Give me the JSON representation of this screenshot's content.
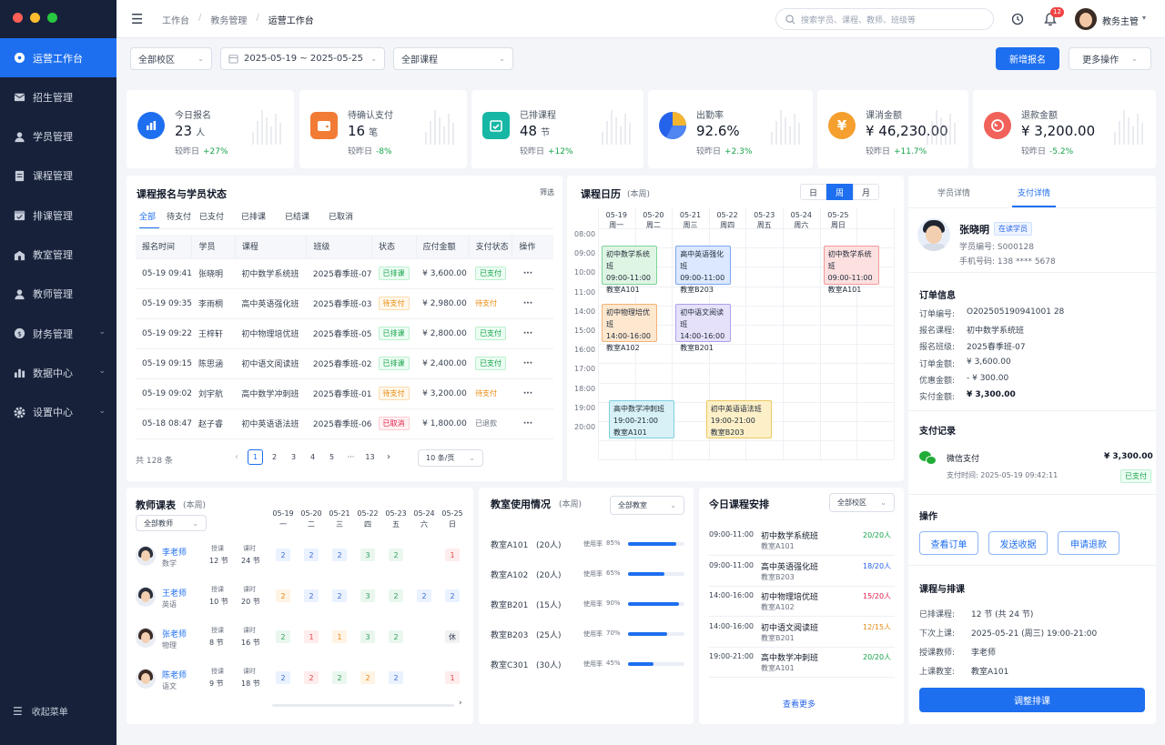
{
  "sidebar": {
    "items": [
      {
        "label": "运营工作台",
        "icon": "dashboard-icon",
        "active": true
      },
      {
        "label": "招生管理",
        "icon": "enrollment-icon"
      },
      {
        "label": "学员管理",
        "icon": "student-icon"
      },
      {
        "label": "课程管理",
        "icon": "course-icon"
      },
      {
        "label": "排课管理",
        "icon": "schedule-icon"
      },
      {
        "label": "教室管理",
        "icon": "classroom-icon"
      },
      {
        "label": "教师管理",
        "icon": "teacher-icon"
      },
      {
        "label": "财务管理",
        "icon": "finance-icon",
        "expandable": true
      },
      {
        "label": "数据中心",
        "icon": "data-icon",
        "expandable": true
      },
      {
        "label": "设置中心",
        "icon": "settings-icon",
        "expandable": true
      }
    ],
    "collapse_label": "收起菜单"
  },
  "topbar": {
    "breadcrumb": [
      "工作台",
      "教务管理",
      "运营工作台"
    ],
    "search_placeholder": "搜索学员、课程、教师、班级等",
    "notification_count": "12",
    "user_name": "教务主管"
  },
  "filters": {
    "campus": "全部校区",
    "date_range": "2025-05-19 ~ 2025-05-25",
    "course": "全部课程",
    "new_button": "新增报名",
    "more_button": "更多操作"
  },
  "stats": [
    {
      "label": "今日报名",
      "value": "23",
      "unit": "人",
      "compare": "较昨日",
      "delta": "+27%",
      "color": "#1e6ff0",
      "icon": "bar-chart-icon"
    },
    {
      "label": "待确认支付",
      "value": "16",
      "unit": "笔",
      "compare": "较昨日",
      "delta": "-8%",
      "color": "#f27b35",
      "icon": "wallet-icon"
    },
    {
      "label": "已排课程",
      "value": "48",
      "unit": "节",
      "compare": "较昨日",
      "delta": "+12%",
      "color": "#16b7a4",
      "icon": "calendar-check-icon"
    },
    {
      "label": "出勤率",
      "value": "92.6%",
      "unit": "",
      "compare": "较昨日",
      "delta": "+2.3%",
      "color": "#2563eb",
      "icon": "pie-chart-icon"
    },
    {
      "label": "课消金额",
      "value": "¥ 46,230.00",
      "unit": "",
      "compare": "较昨日",
      "delta": "+11.7%",
      "color": "#f59f2e",
      "icon": "yen-icon"
    },
    {
      "label": "退款金额",
      "value": "¥ 3,200.00",
      "unit": "",
      "compare": "较昨日",
      "delta": "-5.2%",
      "color": "#f0625a",
      "icon": "refund-icon"
    }
  ],
  "enrollment": {
    "title": "课程报名与学员状态",
    "filter_link": "筛选",
    "tabs": [
      "全部",
      "待支付",
      "已支付",
      "已排课",
      "已结课",
      "已取消"
    ],
    "headers": [
      "报名时间",
      "学员",
      "课程",
      "班级",
      "状态",
      "应付金额",
      "支付状态",
      "操作"
    ],
    "rows": [
      {
        "time": "05-19 09:41",
        "student": "张晓明",
        "course": "初中数学系统班",
        "class": "2025春季班-07",
        "status": "已排课",
        "status_color": "green",
        "amount": "¥ 3,600.00",
        "pay": "已支付",
        "pay_color": "green",
        "more": "···"
      },
      {
        "time": "05-19 09:35",
        "student": "李雨桐",
        "course": "高中英语强化班",
        "class": "2025春季班-03",
        "status": "待支付",
        "status_color": "orange",
        "amount": "¥ 2,980.00",
        "pay": "待支付",
        "pay_color": "orange-text",
        "more": "···"
      },
      {
        "time": "05-19 09:22",
        "student": "王梓轩",
        "course": "初中物理培优班",
        "class": "2025春季班-05",
        "status": "已排课",
        "status_color": "green",
        "amount": "¥ 2,800.00",
        "pay": "已支付",
        "pay_color": "green",
        "more": "···"
      },
      {
        "time": "05-19 09:15",
        "student": "陈思涵",
        "course": "初中语文阅读班",
        "class": "2025春季班-02",
        "status": "已排课",
        "status_color": "green",
        "amount": "¥ 2,400.00",
        "pay": "已支付",
        "pay_color": "green",
        "more": "···"
      },
      {
        "time": "05-19 09:02",
        "student": "刘宇航",
        "course": "高中数学冲刺班",
        "class": "2025春季班-01",
        "status": "待支付",
        "status_color": "orange",
        "amount": "¥ 3,200.00",
        "pay": "待支付",
        "pay_color": "orange-text",
        "more": "···"
      },
      {
        "time": "05-18 08:47",
        "student": "赵子睿",
        "course": "初中英语语法班",
        "class": "2025春季班-06",
        "status": "已取消",
        "status_color": "red",
        "amount": "¥ 1,800.00",
        "pay": "已退款",
        "pay_color": "gray-text",
        "more": "···"
      }
    ],
    "total": "共 128 条",
    "pages": [
      "1",
      "2",
      "3",
      "4",
      "5",
      "···",
      "13"
    ],
    "page_size": "10 条/页"
  },
  "calendar": {
    "title": "课程日历",
    "subtitle": "(本周)",
    "views": [
      "日",
      "周",
      "月"
    ],
    "active_view": "周",
    "days": [
      {
        "date": "05-19",
        "wd": "周一"
      },
      {
        "date": "05-20",
        "wd": "周二"
      },
      {
        "date": "05-21",
        "wd": "周三"
      },
      {
        "date": "05-22",
        "wd": "周四"
      },
      {
        "date": "05-23",
        "wd": "周五"
      },
      {
        "date": "05-24",
        "wd": "周六"
      },
      {
        "date": "05-25",
        "wd": "周日"
      }
    ],
    "hours": [
      "08:00",
      "09:00",
      "10:00",
      "11:00",
      "14:00",
      "15:00",
      "16:00",
      "17:00",
      "18:00",
      "19:00",
      "20:00"
    ],
    "events": [
      {
        "name": "初中数学系统班",
        "time": "09:00-11:00",
        "room": "教室A101",
        "color": "green",
        "day": 0,
        "start": 1,
        "end": 3
      },
      {
        "name": "高中英语强化班",
        "time": "09:00-11:00",
        "room": "教室B203",
        "color": "blue",
        "day": 2,
        "start": 1,
        "end": 3
      },
      {
        "name": "初中数学系统班",
        "time": "09:00-11:00",
        "room": "教室A101",
        "color": "red",
        "day": 6,
        "start": 1,
        "end": 3
      },
      {
        "name": "初中物理培优班",
        "time": "14:00-16:00",
        "room": "教室A102",
        "color": "orange",
        "day": 0,
        "start": 4,
        "end": 6
      },
      {
        "name": "初中语文阅读班",
        "time": "14:00-16:00",
        "room": "教室B201",
        "color": "purple",
        "day": 2,
        "start": 4,
        "end": 6
      },
      {
        "name": "高中数学冲刺班",
        "time": "19:00-21:00",
        "room": "教室A101",
        "color": "cyan",
        "day": 0,
        "start": 9,
        "end": 11
      },
      {
        "name": "初中英语语法班",
        "time": "19:00-21:00",
        "room": "教室B203",
        "color": "yellow",
        "day": 3,
        "start": 9,
        "end": 11
      }
    ]
  },
  "detail": {
    "tabs": [
      "学员详情",
      "支付详情"
    ],
    "active_tab": "支付详情",
    "student": {
      "name": "张晓明",
      "badge": "在读学员",
      "id_label": "学员编号:",
      "id": "S000128",
      "phone_label": "手机号码:",
      "phone": "138 **** 5678"
    },
    "order_title": "订单信息",
    "order": [
      {
        "k": "订单编号:",
        "v": "O202505190941001 28"
      },
      {
        "k": "报名课程:",
        "v": "初中数学系统班"
      },
      {
        "k": "报名班级:",
        "v": "2025春季班-07"
      },
      {
        "k": "订单金额:",
        "v": "¥ 3,600.00"
      },
      {
        "k": "优惠金额:",
        "v": "- ¥ 300.00"
      },
      {
        "k": "实付金额:",
        "v": "¥ 3,300.00"
      }
    ],
    "pay_title": "支付记录",
    "pay_method": "微信支付",
    "pay_amount": "¥ 3,300.00",
    "pay_time": "支付时间: 2025-05-19 09:42:11",
    "pay_status": "已支付",
    "ops_title": "操作",
    "ops": [
      "查看订单",
      "发送收据",
      "申请退款"
    ],
    "sched_title": "课程与排课",
    "sched": [
      {
        "k": "已排课程:",
        "v": "12 节 (共 24 节)"
      },
      {
        "k": "下次上课:",
        "v": "2025-05-21 (周三) 19:00-21:00"
      },
      {
        "k": "授课教师:",
        "v": "李老师"
      },
      {
        "k": "上课教室:",
        "v": "教室A101"
      }
    ],
    "adjust_button": "调整排课"
  },
  "teachers": {
    "title": "教师课表",
    "subtitle": "(本周)",
    "filter": "全部教师",
    "days": [
      {
        "date": "05-19",
        "wd": "一"
      },
      {
        "date": "05-20",
        "wd": "二"
      },
      {
        "date": "05-21",
        "wd": "三"
      },
      {
        "date": "05-22",
        "wd": "四"
      },
      {
        "date": "05-23",
        "wd": "五"
      },
      {
        "date": "05-24",
        "wd": "六"
      },
      {
        "date": "05-25",
        "wd": "日"
      }
    ],
    "class_label": "授课",
    "hour_label": "课时",
    "rows": [
      {
        "name": "李老师",
        "subject": "数学",
        "classes": "12 节",
        "hours": "24 节",
        "cells": [
          [
            "2",
            "b"
          ],
          [
            "2",
            "b"
          ],
          [
            "2",
            "b"
          ],
          [
            "3",
            "g"
          ],
          [
            "2",
            "g"
          ],
          [
            "",
            ""
          ],
          [
            "1",
            "r"
          ]
        ]
      },
      {
        "name": "王老师",
        "subject": "英语",
        "classes": "10 节",
        "hours": "20 节",
        "cells": [
          [
            "2",
            "o"
          ],
          [
            "2",
            "b"
          ],
          [
            "2",
            "b"
          ],
          [
            "3",
            "g"
          ],
          [
            "2",
            "g"
          ],
          [
            "2",
            "b"
          ],
          [
            "2",
            "b"
          ]
        ]
      },
      {
        "name": "张老师",
        "subject": "物理",
        "classes": "8 节",
        "hours": "16 节",
        "cells": [
          [
            "2",
            "g"
          ],
          [
            "1",
            "r"
          ],
          [
            "1",
            "o"
          ],
          [
            "3",
            "g"
          ],
          [
            "2",
            "g"
          ],
          [
            "",
            ""
          ],
          [
            "休",
            "x"
          ]
        ]
      },
      {
        "name": "陈老师",
        "subject": "语文",
        "classes": "9 节",
        "hours": "18 节",
        "cells": [
          [
            "2",
            "b"
          ],
          [
            "2",
            "r"
          ],
          [
            "2",
            "g"
          ],
          [
            "2",
            "o"
          ],
          [
            "2",
            "b"
          ],
          [
            "",
            ""
          ],
          [
            "1",
            "r"
          ]
        ]
      }
    ]
  },
  "rooms": {
    "title": "教室使用情况",
    "subtitle": "(本周)",
    "filter": "全部教室",
    "usage_label": "使用率",
    "items": [
      {
        "name": "教室A101",
        "cap": "(20人)",
        "rate": "85%",
        "pct": 0.85
      },
      {
        "name": "教室A102",
        "cap": "(20人)",
        "rate": "65%",
        "pct": 0.65
      },
      {
        "name": "教室B201",
        "cap": "(15人)",
        "rate": "90%",
        "pct": 0.9
      },
      {
        "name": "教室B203",
        "cap": "(25人)",
        "rate": "70%",
        "pct": 0.7
      },
      {
        "name": "教室C301",
        "cap": "(30人)",
        "rate": "45%",
        "pct": 0.45
      }
    ]
  },
  "today": {
    "title": "今日课程安排",
    "filter": "全部校区",
    "items": [
      {
        "time": "09:00-11:00",
        "course": "初中数学系统班",
        "room": "教室A101",
        "count": "20/20人",
        "color": "#16a34a"
      },
      {
        "time": "09:00-11:00",
        "course": "高中英语强化班",
        "room": "教室B203",
        "count": "18/20人",
        "color": "#2563eb"
      },
      {
        "time": "14:00-16:00",
        "course": "初中物理培优班",
        "room": "教室A102",
        "count": "15/20人",
        "color": "#e11d48"
      },
      {
        "time": "14:00-16:00",
        "course": "初中语文阅读班",
        "room": "教室B201",
        "count": "12/15人",
        "color": "#e58a17"
      },
      {
        "time": "19:00-21:00",
        "course": "高中数学冲刺班",
        "room": "教室A101",
        "count": "20/20人",
        "color": "#16a34a"
      }
    ],
    "more": "查看更多"
  }
}
